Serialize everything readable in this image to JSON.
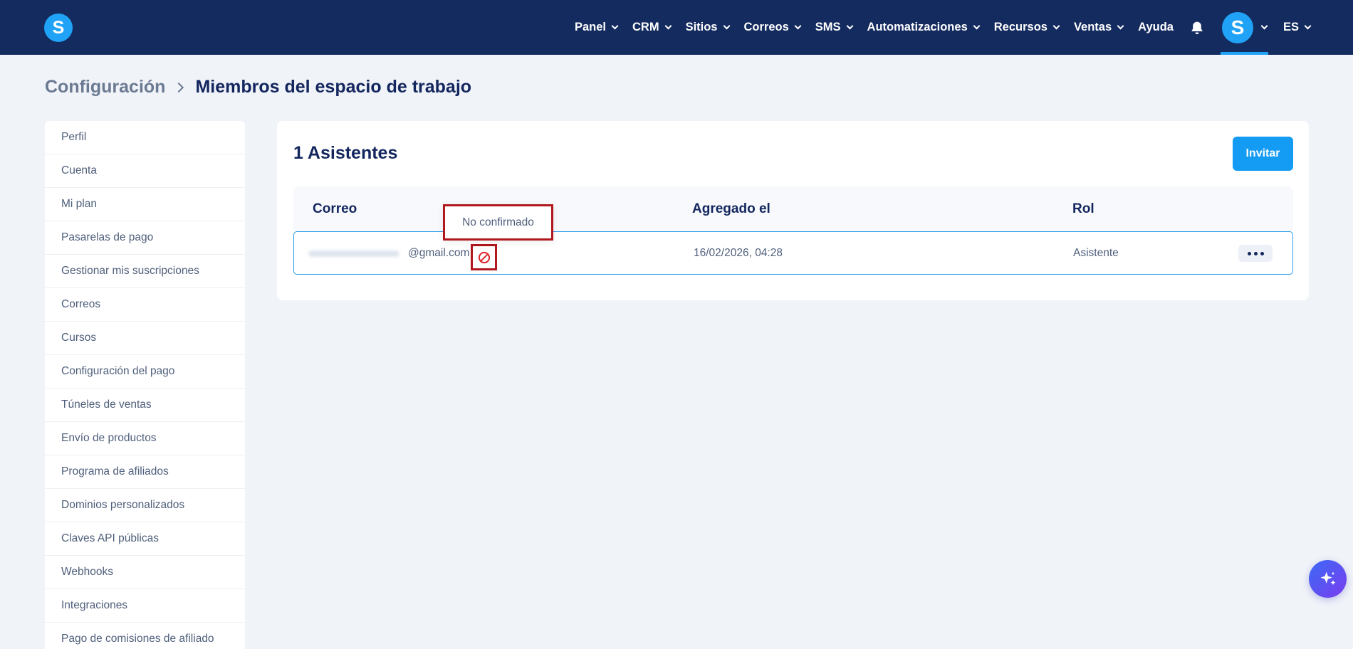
{
  "navbar": {
    "logo_letter": "S",
    "items": [
      {
        "label": "Panel"
      },
      {
        "label": "CRM"
      },
      {
        "label": "Sitios"
      },
      {
        "label": "Correos"
      },
      {
        "label": "SMS"
      },
      {
        "label": "Automatizaciones"
      },
      {
        "label": "Recursos"
      },
      {
        "label": "Ventas"
      }
    ],
    "help_label": "Ayuda",
    "bell_icon": "bell-icon",
    "avatar_letter": "S",
    "language": "ES"
  },
  "breadcrumb": {
    "parent": "Configuración",
    "current": "Miembros del espacio de trabajo"
  },
  "sidebar": {
    "items": [
      {
        "label": "Perfil"
      },
      {
        "label": "Cuenta"
      },
      {
        "label": "Mi plan"
      },
      {
        "label": "Pasarelas de pago"
      },
      {
        "label": "Gestionar mis suscripciones"
      },
      {
        "label": "Correos"
      },
      {
        "label": "Cursos"
      },
      {
        "label": "Configuración del pago"
      },
      {
        "label": "Túneles de ventas"
      },
      {
        "label": "Envío de productos"
      },
      {
        "label": "Programa de afiliados"
      },
      {
        "label": "Dominios personalizados"
      },
      {
        "label": "Claves API públicas"
      },
      {
        "label": "Webhooks"
      },
      {
        "label": "Integraciones"
      },
      {
        "label": "Pago de comisiones de afiliado"
      }
    ]
  },
  "main": {
    "title": "1 Asistentes",
    "invite_label": "Invitar",
    "table": {
      "headers": {
        "email": "Correo",
        "added": "Agregado el",
        "role": "Rol"
      },
      "rows": [
        {
          "email_domain": "@gmail.com",
          "added": "16/02/2026, 04:28",
          "role": "Asistente",
          "status_icon": "ban-icon"
        }
      ]
    },
    "tooltip": "No confirmado"
  },
  "colors": {
    "navbar": "#142b5f",
    "accent": "#149bf4",
    "highlight": "#b0181d",
    "text_dark": "#13265e"
  },
  "fab_icon": "sparkle-icon"
}
